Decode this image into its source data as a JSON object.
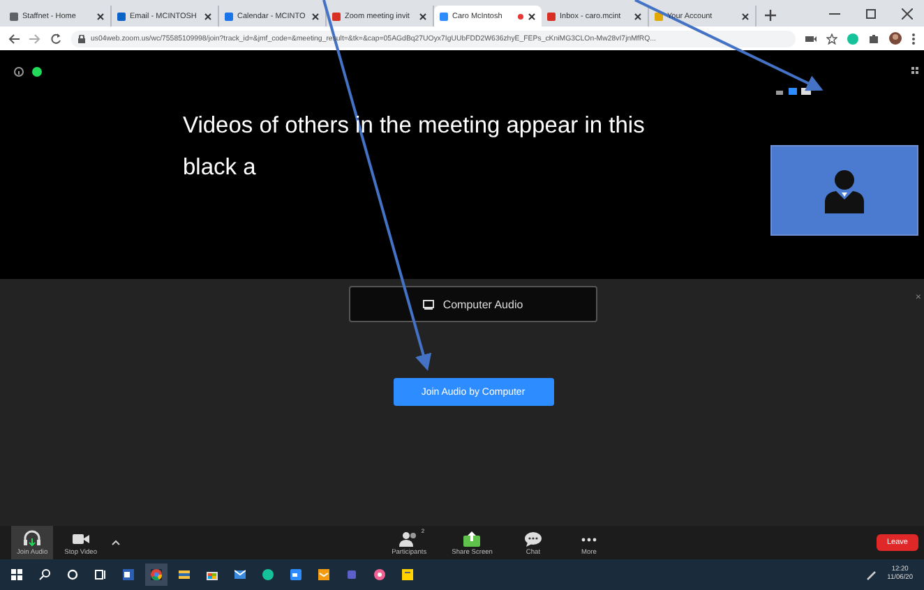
{
  "browser": {
    "tabs": [
      {
        "label": "Staffnet - Home",
        "color": "#5f6368",
        "selected": false,
        "recording": false
      },
      {
        "label": "Email - MCINTOSH",
        "color": "#0a64c8",
        "selected": false,
        "recording": false
      },
      {
        "label": "Calendar - MCINTO",
        "color": "#1a73e8",
        "selected": false,
        "recording": false
      },
      {
        "label": "Zoom meeting invit",
        "color": "#d93025",
        "selected": false,
        "recording": false
      },
      {
        "label": "Caro McIntosh",
        "color": "#2d8cff",
        "selected": true,
        "recording": true
      },
      {
        "label": "Inbox - caro.mcint",
        "color": "#d93025",
        "selected": false,
        "recording": false
      },
      {
        "label": "Your Account",
        "color": "#e0a800",
        "selected": false,
        "recording": false
      }
    ],
    "url": "us04web.zoom.us/wc/75585109998/join?track_id=&jmf_code=&meeting_result=&tk=&cap=05AGdBq27UOyx7IgUUbFDD2W636zhyE_FEPs_cKniMG3CLOn-Mw28vI7jnMfRQ..."
  },
  "meeting": {
    "caption": "Videos of others in the meeting appear in this black a",
    "audio_popup": "Computer Audio",
    "join_button": "Join Audio by Computer",
    "close": "×"
  },
  "toolbar": {
    "left": [
      {
        "label": "Join Audio",
        "kind": "headphones",
        "selected": true
      },
      {
        "label": "Stop Video",
        "kind": "camera",
        "selected": false
      }
    ],
    "center": [
      {
        "label": "Participants",
        "kind": "participants",
        "badge": "2"
      },
      {
        "label": "Share Screen",
        "kind": "share"
      },
      {
        "label": "Chat",
        "kind": "chat"
      },
      {
        "label": "More",
        "kind": "more"
      }
    ],
    "leave": "Leave"
  },
  "taskbar": {
    "time": "12:20",
    "date": "11/06/20"
  }
}
